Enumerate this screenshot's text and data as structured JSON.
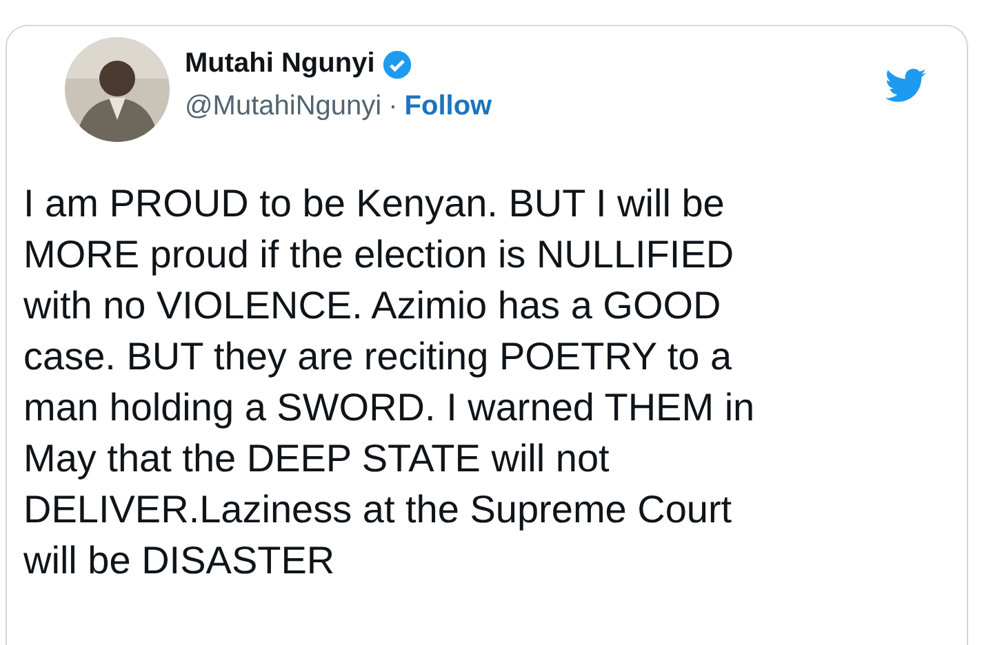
{
  "author": {
    "name": "Mutahi Ngunyi",
    "verified": true,
    "handle": "@MutahiNgunyi",
    "separator": "·",
    "follow": "Follow"
  },
  "tweet": {
    "text": "I am PROUD to be Kenyan. BUT I will be\nMORE proud if the election is NULLIFIED\nwith no VIOLENCE. Azimio has a GOOD\ncase. BUT they are reciting POETRY to a\nman holding a SWORD. I warned THEM in\nMay that the DEEP STATE will not\nDELIVER.Laziness at the Supreme Court\nwill be DISASTER"
  }
}
